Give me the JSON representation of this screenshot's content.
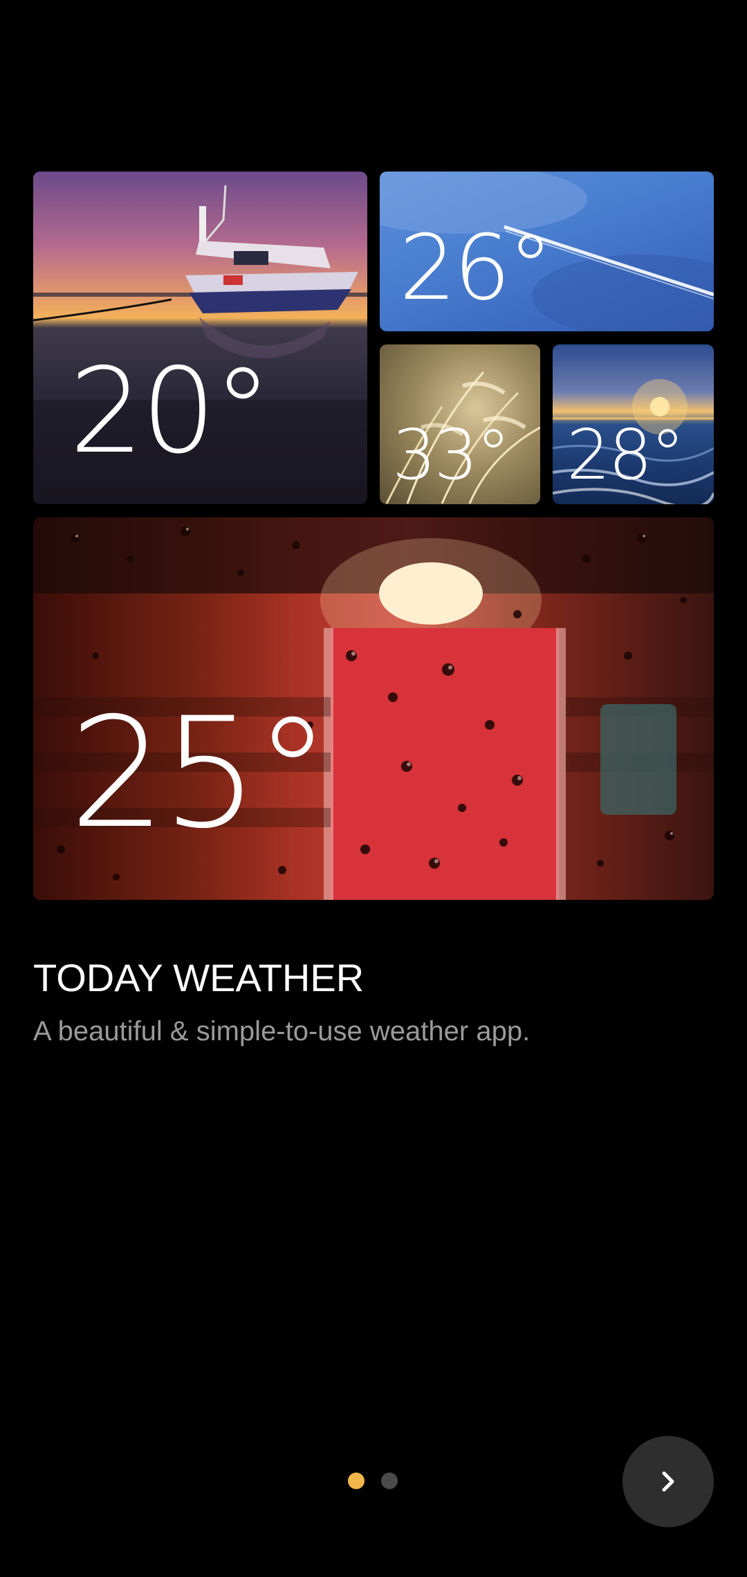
{
  "tiles": [
    {
      "id": "boat",
      "temperature": "20°",
      "scene": "sunset-boat"
    },
    {
      "id": "sky",
      "temperature": "26°",
      "scene": "blue-sky-contrail"
    },
    {
      "id": "grass",
      "temperature": "33°",
      "scene": "golden-grass"
    },
    {
      "id": "sea",
      "temperature": "28°",
      "scene": "sea-sunset"
    },
    {
      "id": "rain",
      "temperature": "25°",
      "scene": "rain-drops-red-door"
    }
  ],
  "intro": {
    "title": "TODAY WEATHER",
    "subtitle": "A beautiful & simple-to-use weather app."
  },
  "pager": {
    "current_page": 1,
    "total_pages": 2
  },
  "next_button": {
    "icon": "chevron-right-icon"
  },
  "colors": {
    "background": "#000000",
    "active_dot": "#f2b74a",
    "inactive_dot": "#4a4a4a",
    "subtitle": "#9a9a9a",
    "button": "#2e2e2e"
  }
}
